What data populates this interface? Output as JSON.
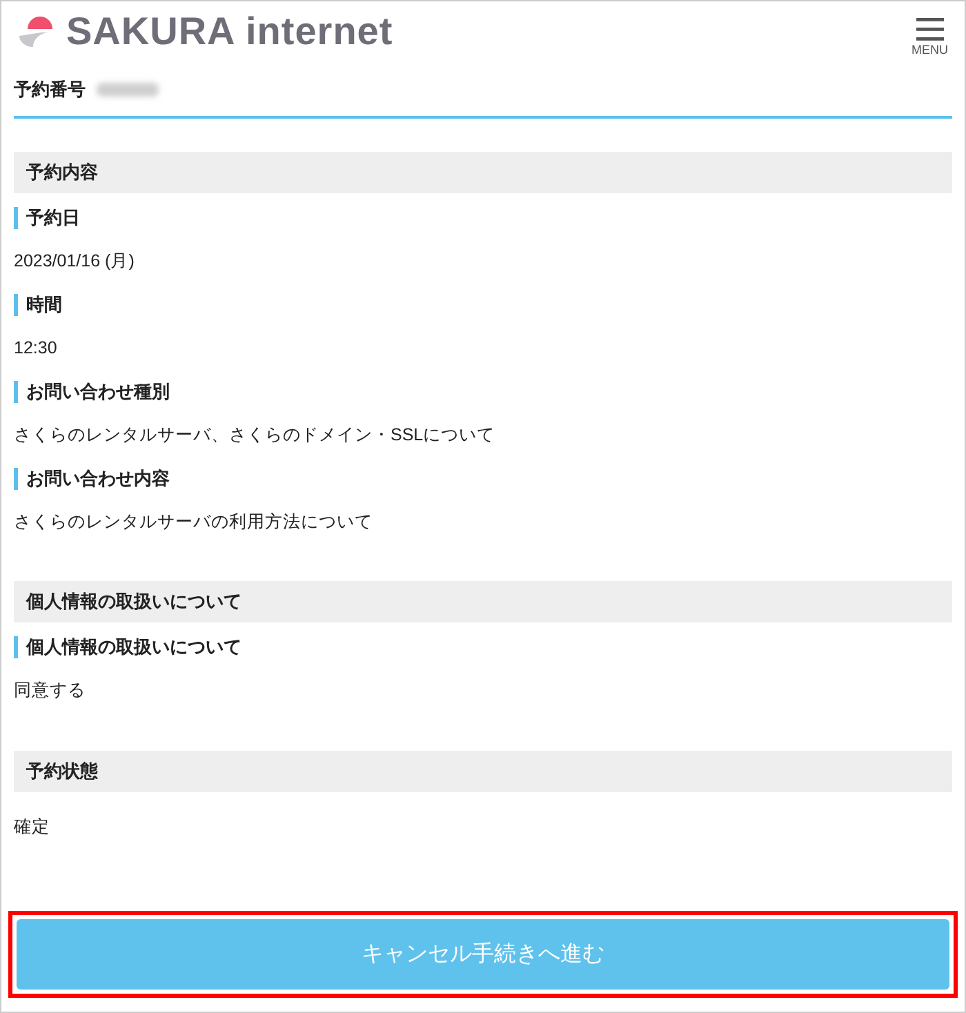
{
  "header": {
    "logo_text": "SAKURA internet",
    "menu_label": "MENU"
  },
  "reservation": {
    "label": "予約番号",
    "number_redacted": true
  },
  "sections": [
    {
      "title": "予約内容",
      "items": [
        {
          "label": "予約日",
          "value": "2023/01/16 (月)"
        },
        {
          "label": "時間",
          "value": "12:30"
        },
        {
          "label": "お問い合わせ種別",
          "value": "さくらのレンタルサーバ、さくらのドメイン・SSLについて"
        },
        {
          "label": "お問い合わせ内容",
          "value": "さくらのレンタルサーバの利用方法について"
        }
      ]
    },
    {
      "title": "個人情報の取扱いについて",
      "items": [
        {
          "label": "個人情報の取扱いについて",
          "value": "同意する"
        }
      ]
    },
    {
      "title": "予約状態",
      "items": [
        {
          "value": "確定"
        }
      ]
    }
  ],
  "cancel_button": {
    "label": "キャンセル手続きへ進む",
    "highlighted": true
  }
}
